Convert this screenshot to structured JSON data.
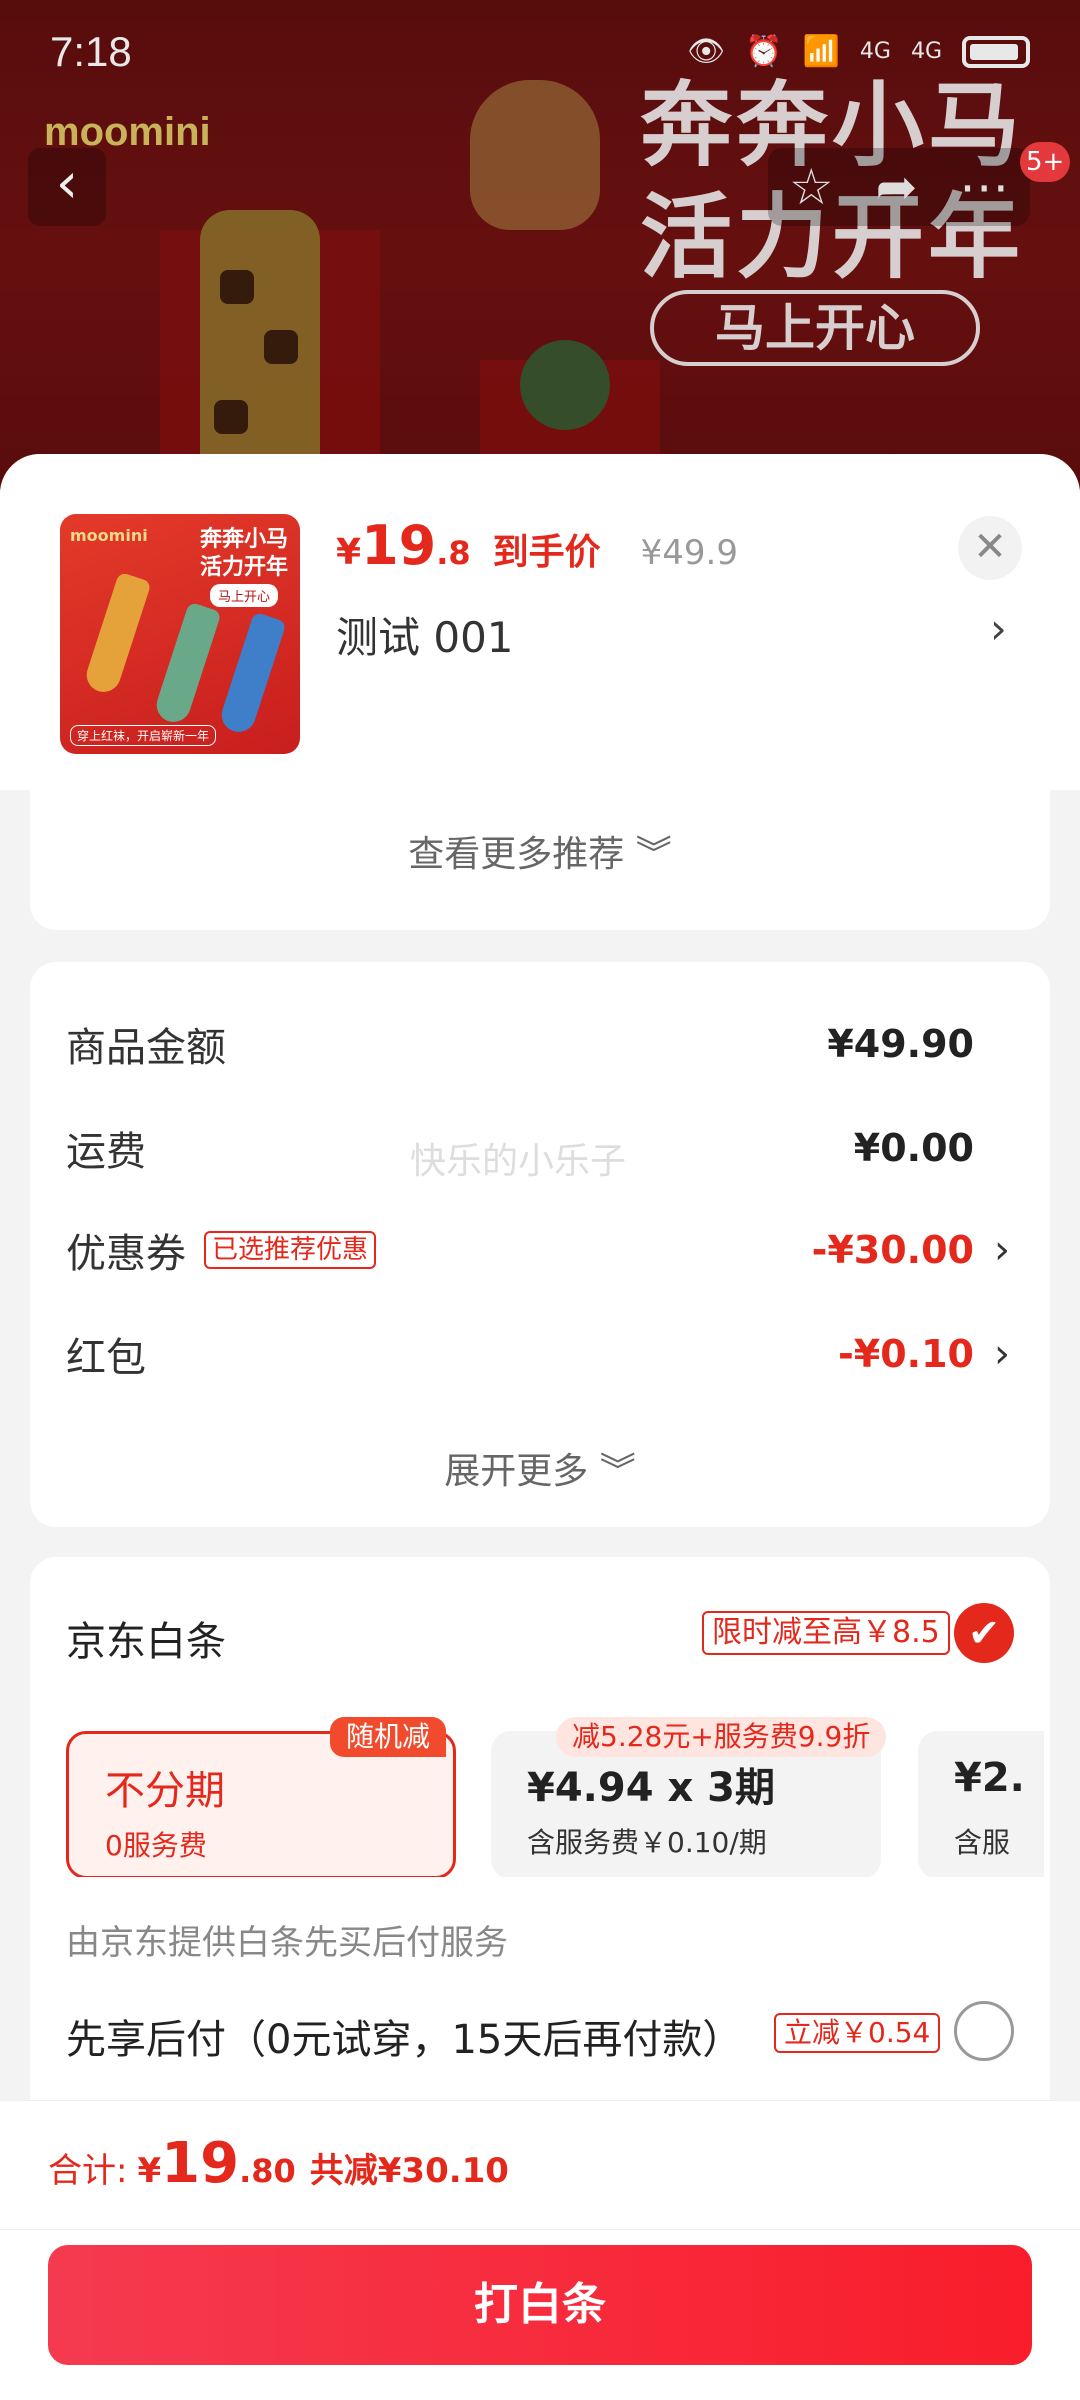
{
  "status_bar": {
    "time": "7:18",
    "signal_1": "4G",
    "signal_2": "4G"
  },
  "product_page": {
    "brand": "moomini",
    "hero_title_1": "奔奔小马",
    "hero_title_2": "活力开年",
    "hero_subtitle": "马上开心",
    "more_badge": "5+"
  },
  "sheet": {
    "thumb": {
      "brand": "moomini",
      "title_1": "奔奔小马",
      "title_2": "活力开年",
      "pill": "马上开心",
      "footer": "穿上红袜，开启崭新一年"
    },
    "price": {
      "yen": "¥",
      "int": "19",
      "dec": ".8",
      "label": "到手价",
      "original": "¥49.9"
    },
    "spec": "测试  001",
    "more_recommend": "查看更多推荐 ︾"
  },
  "amounts": {
    "goods_label": "商品金额",
    "goods_value": "¥49.90",
    "shipping_label": "运费",
    "shipping_value": "¥0.00",
    "coupon_label": "优惠券",
    "coupon_tag": "已选推荐优惠",
    "coupon_value": "-¥30.00",
    "redpacket_label": "红包",
    "redpacket_value": "-¥0.10",
    "watermark": "快乐的小乐子",
    "expand_more": "展开更多 ︾"
  },
  "baitiao": {
    "title": "京东白条",
    "promo": "限时减至高￥8.5",
    "plans": [
      {
        "main": "不分期",
        "sub": "0服务费",
        "tag": "随机减"
      },
      {
        "main": "¥4.94 x 3期",
        "sub": "含服务费￥0.10/期",
        "tag": "减5.28元+服务费9.9折"
      },
      {
        "main": "¥2.",
        "sub": "含服"
      }
    ],
    "note": "由京东提供白条先买后付服务",
    "later_label": "先享后付（0元试穿，15天后再付款）",
    "later_tag": "立减￥0.54"
  },
  "footer": {
    "total_label": "合计:",
    "total_yen": "¥",
    "total_int": "19",
    "total_dec": ".80",
    "total_saved": "共减¥30.10",
    "pay_button": "打白条"
  },
  "colors": {
    "accent_red": "#e4281c",
    "button_gradient_start": "#f53a4f",
    "button_gradient_end": "#f91d2b"
  },
  "icons": [
    "back-icon",
    "star-icon",
    "share-icon",
    "more-icon",
    "close-icon",
    "chevron-right-icon",
    "check-icon",
    "radio-icon"
  ]
}
